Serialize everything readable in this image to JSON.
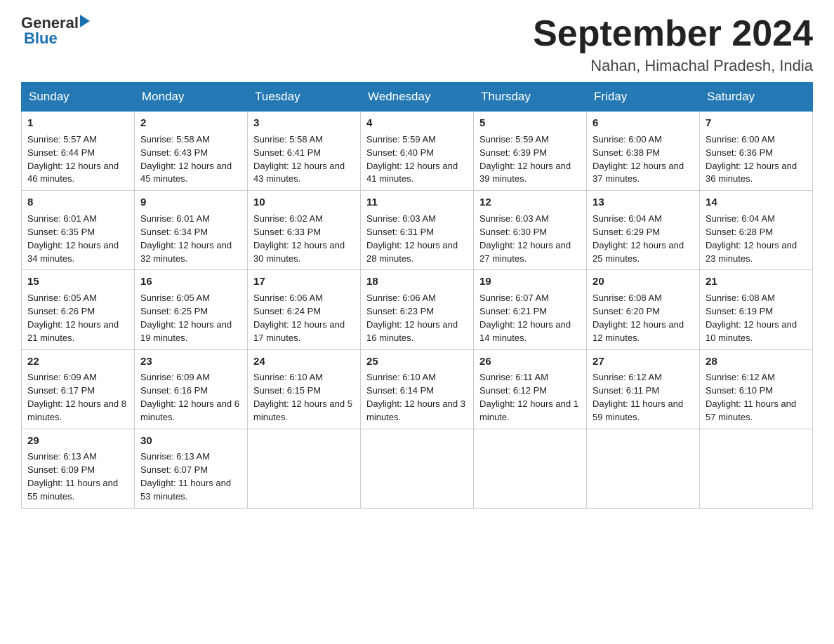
{
  "logo": {
    "general": "General",
    "blue": "Blue"
  },
  "title": "September 2024",
  "subtitle": "Nahan, Himachal Pradesh, India",
  "weekdays": [
    "Sunday",
    "Monday",
    "Tuesday",
    "Wednesday",
    "Thursday",
    "Friday",
    "Saturday"
  ],
  "weeks": [
    [
      {
        "day": "1",
        "sunrise": "5:57 AM",
        "sunset": "6:44 PM",
        "daylight": "12 hours and 46 minutes."
      },
      {
        "day": "2",
        "sunrise": "5:58 AM",
        "sunset": "6:43 PM",
        "daylight": "12 hours and 45 minutes."
      },
      {
        "day": "3",
        "sunrise": "5:58 AM",
        "sunset": "6:41 PM",
        "daylight": "12 hours and 43 minutes."
      },
      {
        "day": "4",
        "sunrise": "5:59 AM",
        "sunset": "6:40 PM",
        "daylight": "12 hours and 41 minutes."
      },
      {
        "day": "5",
        "sunrise": "5:59 AM",
        "sunset": "6:39 PM",
        "daylight": "12 hours and 39 minutes."
      },
      {
        "day": "6",
        "sunrise": "6:00 AM",
        "sunset": "6:38 PM",
        "daylight": "12 hours and 37 minutes."
      },
      {
        "day": "7",
        "sunrise": "6:00 AM",
        "sunset": "6:36 PM",
        "daylight": "12 hours and 36 minutes."
      }
    ],
    [
      {
        "day": "8",
        "sunrise": "6:01 AM",
        "sunset": "6:35 PM",
        "daylight": "12 hours and 34 minutes."
      },
      {
        "day": "9",
        "sunrise": "6:01 AM",
        "sunset": "6:34 PM",
        "daylight": "12 hours and 32 minutes."
      },
      {
        "day": "10",
        "sunrise": "6:02 AM",
        "sunset": "6:33 PM",
        "daylight": "12 hours and 30 minutes."
      },
      {
        "day": "11",
        "sunrise": "6:03 AM",
        "sunset": "6:31 PM",
        "daylight": "12 hours and 28 minutes."
      },
      {
        "day": "12",
        "sunrise": "6:03 AM",
        "sunset": "6:30 PM",
        "daylight": "12 hours and 27 minutes."
      },
      {
        "day": "13",
        "sunrise": "6:04 AM",
        "sunset": "6:29 PM",
        "daylight": "12 hours and 25 minutes."
      },
      {
        "day": "14",
        "sunrise": "6:04 AM",
        "sunset": "6:28 PM",
        "daylight": "12 hours and 23 minutes."
      }
    ],
    [
      {
        "day": "15",
        "sunrise": "6:05 AM",
        "sunset": "6:26 PM",
        "daylight": "12 hours and 21 minutes."
      },
      {
        "day": "16",
        "sunrise": "6:05 AM",
        "sunset": "6:25 PM",
        "daylight": "12 hours and 19 minutes."
      },
      {
        "day": "17",
        "sunrise": "6:06 AM",
        "sunset": "6:24 PM",
        "daylight": "12 hours and 17 minutes."
      },
      {
        "day": "18",
        "sunrise": "6:06 AM",
        "sunset": "6:23 PM",
        "daylight": "12 hours and 16 minutes."
      },
      {
        "day": "19",
        "sunrise": "6:07 AM",
        "sunset": "6:21 PM",
        "daylight": "12 hours and 14 minutes."
      },
      {
        "day": "20",
        "sunrise": "6:08 AM",
        "sunset": "6:20 PM",
        "daylight": "12 hours and 12 minutes."
      },
      {
        "day": "21",
        "sunrise": "6:08 AM",
        "sunset": "6:19 PM",
        "daylight": "12 hours and 10 minutes."
      }
    ],
    [
      {
        "day": "22",
        "sunrise": "6:09 AM",
        "sunset": "6:17 PM",
        "daylight": "12 hours and 8 minutes."
      },
      {
        "day": "23",
        "sunrise": "6:09 AM",
        "sunset": "6:16 PM",
        "daylight": "12 hours and 6 minutes."
      },
      {
        "day": "24",
        "sunrise": "6:10 AM",
        "sunset": "6:15 PM",
        "daylight": "12 hours and 5 minutes."
      },
      {
        "day": "25",
        "sunrise": "6:10 AM",
        "sunset": "6:14 PM",
        "daylight": "12 hours and 3 minutes."
      },
      {
        "day": "26",
        "sunrise": "6:11 AM",
        "sunset": "6:12 PM",
        "daylight": "12 hours and 1 minute."
      },
      {
        "day": "27",
        "sunrise": "6:12 AM",
        "sunset": "6:11 PM",
        "daylight": "11 hours and 59 minutes."
      },
      {
        "day": "28",
        "sunrise": "6:12 AM",
        "sunset": "6:10 PM",
        "daylight": "11 hours and 57 minutes."
      }
    ],
    [
      {
        "day": "29",
        "sunrise": "6:13 AM",
        "sunset": "6:09 PM",
        "daylight": "11 hours and 55 minutes."
      },
      {
        "day": "30",
        "sunrise": "6:13 AM",
        "sunset": "6:07 PM",
        "daylight": "11 hours and 53 minutes."
      },
      null,
      null,
      null,
      null,
      null
    ]
  ]
}
